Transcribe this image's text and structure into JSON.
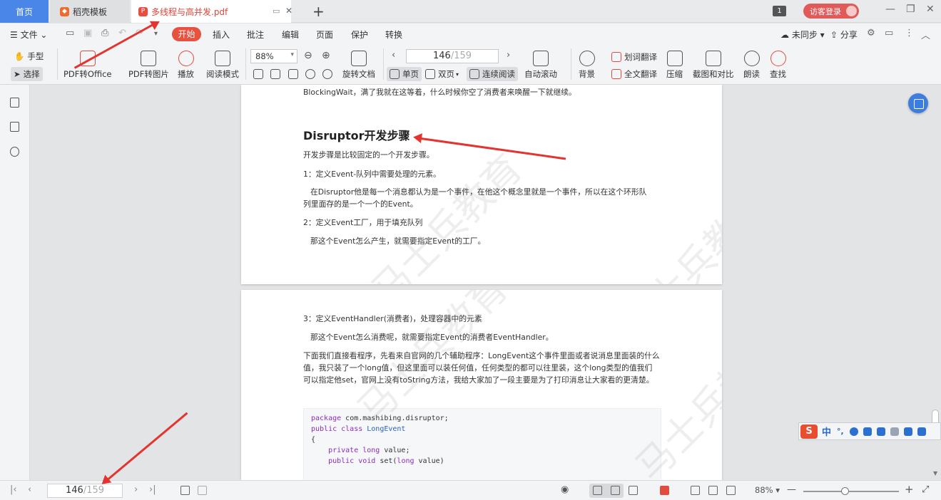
{
  "tabs": {
    "home": "首页",
    "templates": "稻壳模板",
    "document": "多线程与高并发.pdf",
    "new_tab": "+",
    "window_count": "1",
    "login": "访客登录"
  },
  "menu": {
    "file": "文件",
    "items": [
      "开始",
      "插入",
      "批注",
      "编辑",
      "页面",
      "保护",
      "转换"
    ],
    "sync": "未同步",
    "share": "分享"
  },
  "toolbar": {
    "hand": "手型",
    "select": "选择",
    "pdf_to_office": "PDF转Office",
    "pdf_to_image": "PDF转图片",
    "play": "播放",
    "read_mode": "阅读模式",
    "zoom": "88%",
    "rotate": "旋转文档",
    "current_page": "146",
    "total_pages": "/159",
    "single": "单页",
    "double": "双页",
    "continuous": "连续阅读",
    "auto_scroll": "自动滚动",
    "background": "背景",
    "word_translate": "划词翻译",
    "full_translate": "全文翻译",
    "compress": "压缩",
    "crop_compare": "截图和对比",
    "read_aloud": "朗读",
    "find": "查找"
  },
  "doc": {
    "page1": {
      "top_line": "BlockingWait，满了我就在这等着，什么时候你空了消费者来唤醒一下就继续。",
      "heading": "Disruptor开发步骤",
      "intro": "开发步骤是比较固定的一个开发步骤。",
      "step1": "1：定义Event-队列中需要处理的元素。",
      "step1_desc_1": "在Disruptor他是每一个消息都认为是一个事件，在他这个概念里就是一个事件，所以在这个环形队",
      "step1_desc_2": "列里面存的是一个一个的Event。",
      "step2": "2：定义Event工厂，用于填充队列",
      "step2_desc": "那这个Event怎么产生，就需要指定Event的工厂。"
    },
    "page2": {
      "step3": "3：定义EventHandler(消费者)，处理容器中的元素",
      "step3_desc": "那这个Event怎么消费呢，就需要指定Event的消费者EventHandler。",
      "body": "下面我们直接看程序，先看来自官网的几个辅助程序：LongEvent这个事件里面或者说消息里面装的什么值，我只装了一个long值，但这里面可以装任何值，任何类型的都可以往里装，这个long类型的值我们可以指定他set，官网上没有toString方法，我给大家加了一段主要是为了打印消息让大家看的更清楚。",
      "code": {
        "l1_kw": "package",
        "l1_rest": " com.mashibing.disruptor;",
        "l2_kw": "public class",
        "l2_type": " LongEvent",
        "l3": "{",
        "l4_kw": "    private long",
        "l4_rest": " value;",
        "l5": "",
        "l6_kw": "    public void",
        "l6_rest": " set(",
        "l6_kw2": "long",
        "l6_end": " value)"
      }
    },
    "watermark": "马士兵教育"
  },
  "ime": {
    "logo": "S",
    "mode": "中",
    "punct": "°,"
  },
  "statusbar": {
    "current_page": "146",
    "total_pages": "/159",
    "zoom": "88%",
    "zoom_fraction": 0.44
  }
}
